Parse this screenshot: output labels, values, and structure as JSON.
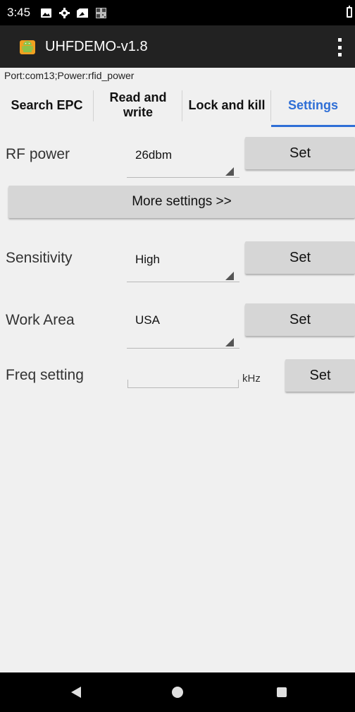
{
  "status_bar": {
    "time": "3:45",
    "icons": [
      "image-icon",
      "gear-icon",
      "sim-icon",
      "qr-icon",
      "battery-icon"
    ]
  },
  "app_bar": {
    "title": "UHFDEMO-v1.8",
    "logo": "android-logo-icon",
    "menu": "overflow-menu-icon"
  },
  "port_info": "Port:com13;Power:rfid_power",
  "tabs": [
    {
      "label": "Search EPC",
      "active": false
    },
    {
      "label": "Read and write",
      "active": false
    },
    {
      "label": "Lock and kill",
      "active": false
    },
    {
      "label": "Settings",
      "active": true
    }
  ],
  "settings": {
    "rf_power": {
      "label": "RF power",
      "value": "26dbm",
      "button": "Set"
    },
    "more_settings": "More settings >>",
    "sensitivity": {
      "label": "Sensitivity",
      "value": "High",
      "button": "Set"
    },
    "work_area": {
      "label": "Work Area",
      "value": "USA",
      "button": "Set"
    },
    "freq_setting": {
      "label": "Freq setting",
      "value": "",
      "unit": "kHz",
      "button": "Set"
    }
  },
  "nav_bar": {
    "buttons": [
      "back-icon",
      "home-icon",
      "recents-icon"
    ]
  },
  "colors": {
    "accent": "#2f6fd6",
    "app_bar": "#222222",
    "button": "#d6d6d6",
    "background": "#f0f0f0"
  }
}
